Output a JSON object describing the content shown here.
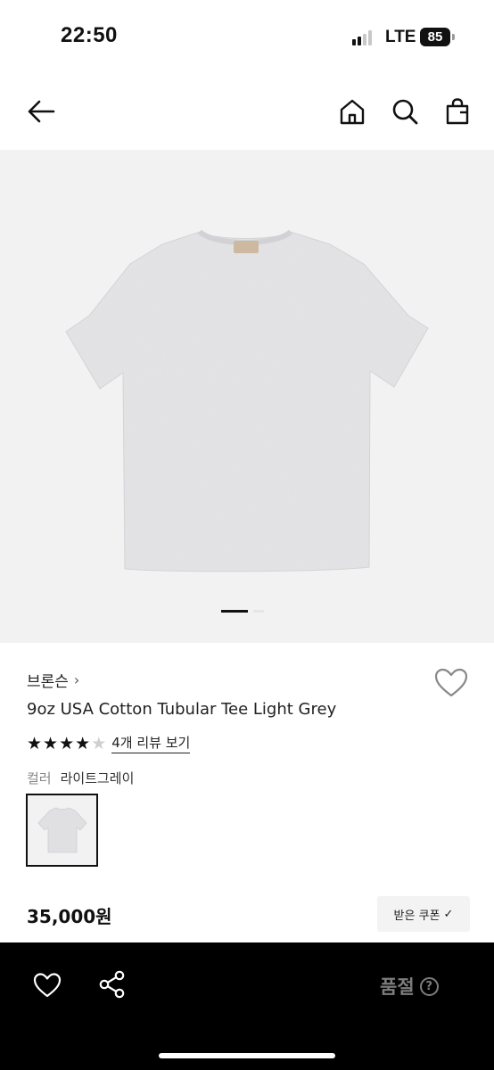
{
  "status_bar": {
    "time": "22:50",
    "network": "LTE",
    "battery": "85"
  },
  "nav": {
    "back_icon": "arrow-left-icon",
    "home_icon": "home-icon",
    "search_icon": "search-icon",
    "cart_icon": "shopping-bag-icon"
  },
  "gallery": {
    "image_label": "light grey t-shirt",
    "page_index": 1,
    "page_count": 2
  },
  "product": {
    "brand": "브론슨",
    "brand_chevron": "›",
    "title": "9oz USA Cotton Tubular Tee Light Grey",
    "rating": 4,
    "rating_max": 5,
    "review_link": "4개 리뷰 보기",
    "color_label": "컬러",
    "color_value": "라이트그레이",
    "price": "35,000원",
    "coupon_label": "받은 쿠폰",
    "coupon_check": "✓"
  },
  "bottom_bar": {
    "soldout_label": "품절",
    "help_glyph": "?"
  },
  "colors": {
    "tee": "#e4e4e6",
    "background": "#f2f2f2",
    "bar": "#000000",
    "soldout": "#7d7d7d"
  }
}
